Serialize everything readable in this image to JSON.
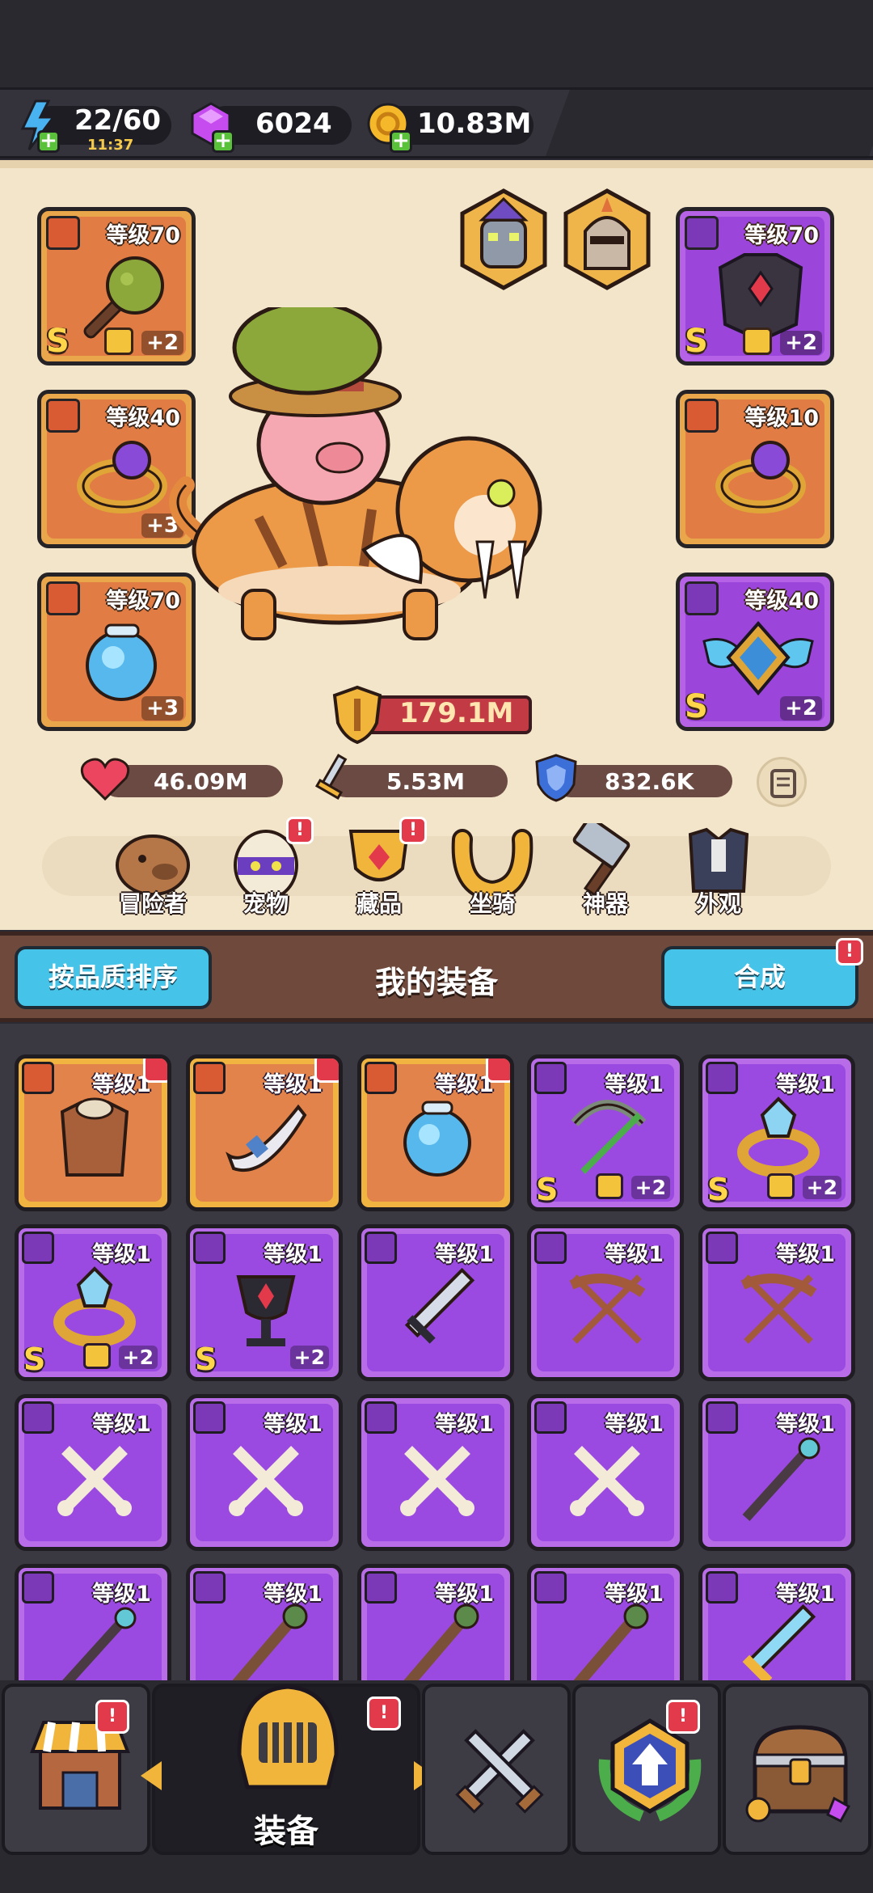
{
  "resources": {
    "energy": "22/60",
    "energy_timer": "11:37",
    "gems": "6024",
    "gold": "10.83M"
  },
  "equipped": {
    "left": [
      {
        "level": "等级70",
        "icon": "spiked-club-icon",
        "tier": "S",
        "bonus": "+2",
        "locked": true,
        "rarity": "orange"
      },
      {
        "level": "等级40",
        "icon": "amethyst-ring-icon",
        "bonus": "+3",
        "rarity": "orange"
      },
      {
        "level": "等级70",
        "icon": "crystal-orb-icon",
        "bonus": "+3",
        "rarity": "orange"
      }
    ],
    "right": [
      {
        "level": "等级70",
        "icon": "dark-armor-icon",
        "tier": "S",
        "bonus": "+2",
        "locked": true,
        "rarity": "purple"
      },
      {
        "level": "等级10",
        "icon": "amethyst-ring-icon",
        "rarity": "orange"
      },
      {
        "level": "等级40",
        "icon": "winged-emblem-icon",
        "tier": "S",
        "bonus": "+2",
        "rarity": "purple"
      }
    ]
  },
  "power": "179.1M",
  "stats": {
    "hp": "46.09M",
    "attack": "5.53M",
    "defense": "832.6K"
  },
  "nav": [
    {
      "label": "冒险者",
      "icon": "capybara-icon",
      "badge": false
    },
    {
      "label": "宠物",
      "icon": "egg-icon",
      "badge": true
    },
    {
      "label": "藏品",
      "icon": "trophy-icon",
      "badge": true
    },
    {
      "label": "坐骑",
      "icon": "horseshoe-icon",
      "badge": false
    },
    {
      "label": "神器",
      "icon": "hammer-icon",
      "badge": false
    },
    {
      "label": "外观",
      "icon": "outfit-icon",
      "badge": false
    }
  ],
  "equipment_header": {
    "sort_button": "按品质排序",
    "title": "我的装备",
    "merge_button": "合成",
    "merge_badge": "!"
  },
  "inventory": [
    {
      "level": "等级1",
      "icon": "leather-armor-icon",
      "rarity": "orange",
      "upgrade": true
    },
    {
      "level": "等级1",
      "icon": "horn-necklace-icon",
      "rarity": "orange",
      "upgrade": true
    },
    {
      "level": "等级1",
      "icon": "crystal-orb-icon",
      "rarity": "orange",
      "upgrade": true
    },
    {
      "level": "等级1",
      "icon": "vine-bow-icon",
      "rarity": "purple",
      "tier": "S",
      "bonus": "+2",
      "locked": true
    },
    {
      "level": "等级1",
      "icon": "crystal-ring-icon",
      "rarity": "purple",
      "tier": "S",
      "bonus": "+2",
      "locked": true
    },
    {
      "level": "等级1",
      "icon": "crystal-ring-icon",
      "rarity": "purple",
      "tier": "S",
      "bonus": "+2",
      "locked": true
    },
    {
      "level": "等级1",
      "icon": "ruby-chalice-icon",
      "rarity": "purple",
      "tier": "S",
      "bonus": "+2"
    },
    {
      "level": "等级1",
      "icon": "broadsword-icon",
      "rarity": "purple"
    },
    {
      "level": "等级1",
      "icon": "crossed-arrows-bow-icon",
      "rarity": "purple"
    },
    {
      "level": "等级1",
      "icon": "crossed-arrows-bow-icon",
      "rarity": "purple"
    },
    {
      "level": "等级1",
      "icon": "bone-club-icon",
      "rarity": "purple"
    },
    {
      "level": "等级1",
      "icon": "bone-club-icon",
      "rarity": "purple"
    },
    {
      "level": "等级1",
      "icon": "bone-club-icon",
      "rarity": "purple"
    },
    {
      "level": "等级1",
      "icon": "bone-club-icon",
      "rarity": "purple"
    },
    {
      "level": "等级1",
      "icon": "magic-staff-icon",
      "rarity": "purple"
    },
    {
      "level": "等级1",
      "icon": "magic-staff-icon",
      "rarity": "purple"
    },
    {
      "level": "等级1",
      "icon": "wooden-staff-icon",
      "rarity": "purple"
    },
    {
      "level": "等级1",
      "icon": "wooden-staff-icon",
      "rarity": "purple"
    },
    {
      "level": "等级1",
      "icon": "wooden-staff-icon",
      "rarity": "purple"
    },
    {
      "level": "等级1",
      "icon": "ice-sword-icon",
      "rarity": "purple"
    }
  ],
  "tabs": [
    {
      "label": "",
      "icon": "shop-icon",
      "badge": "!"
    },
    {
      "label": "装备",
      "icon": "helmet-icon",
      "badge": "!",
      "active": true
    },
    {
      "label": "",
      "icon": "crossed-swords-icon",
      "badge": ""
    },
    {
      "label": "",
      "icon": "upgrade-emblem-icon",
      "badge": "!"
    },
    {
      "label": "",
      "icon": "treasure-chest-icon",
      "badge": ""
    }
  ]
}
